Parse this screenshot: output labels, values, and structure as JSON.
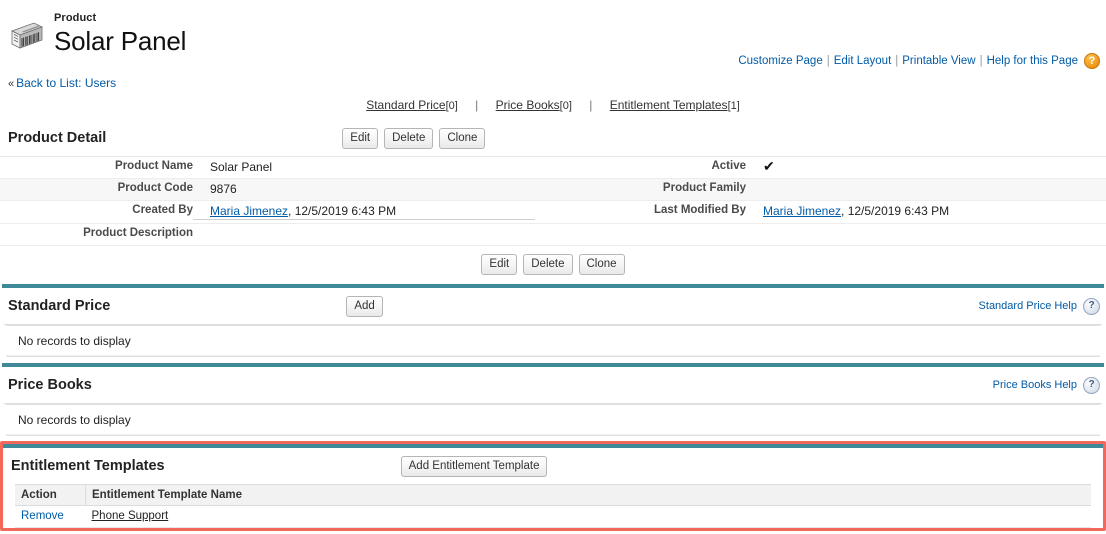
{
  "header": {
    "record_type_label": "Product",
    "record_name": "Solar Panel",
    "icon": "barcode-product-icon"
  },
  "top_links": {
    "items": [
      {
        "label": "Customize Page"
      },
      {
        "label": "Edit Layout"
      },
      {
        "label": "Printable View"
      },
      {
        "label": "Help for this Page"
      }
    ],
    "separator": "|",
    "help_icon_glyph": "?",
    "help_icon_color": "#f0981d"
  },
  "back_to_list": {
    "chevron": "«",
    "label": "Back to List: Users"
  },
  "quick_links": {
    "separator": "|",
    "items": [
      {
        "label": "Standard Price",
        "count": "[0]"
      },
      {
        "label": "Price Books",
        "count": "[0]"
      },
      {
        "label": "Entitlement Templates",
        "count": "[1]"
      }
    ]
  },
  "product_detail": {
    "title": "Product Detail",
    "buttons": [
      {
        "label": "Edit"
      },
      {
        "label": "Delete"
      },
      {
        "label": "Clone"
      }
    ],
    "rows": [
      {
        "left_label": "Product Name",
        "left_value": "Solar Panel",
        "right_label": "Active",
        "right_value": "✔"
      },
      {
        "left_label": "Product Code",
        "left_value": "9876",
        "right_label": "Product Family",
        "right_value": ""
      },
      {
        "left_label": "Created By",
        "left_value_link": "Maria Jimenez",
        "left_value_rest": ", 12/5/2019 6:43 PM",
        "right_label": "Last Modified By",
        "right_value_link": "Maria Jimenez",
        "right_value_rest": ", 12/5/2019 6:43 PM"
      },
      {
        "left_label": "Product Description",
        "left_value": "",
        "right_label": "",
        "right_value": ""
      }
    ]
  },
  "standard_price": {
    "title": "Standard Price",
    "add_button": "Add",
    "help_link": "Standard Price Help",
    "help_icon_glyph": "?",
    "empty_message": "No records to display"
  },
  "price_books": {
    "title": "Price Books",
    "help_link": "Price Books Help",
    "help_icon_glyph": "?",
    "empty_message": "No records to display"
  },
  "entitlement_templates": {
    "title": "Entitlement Templates",
    "add_button": "Add Entitlement Template",
    "highlight_color": "#f2695c",
    "columns": [
      {
        "label": "Action"
      },
      {
        "label": "Entitlement Template Name"
      }
    ],
    "rows": [
      {
        "action": "Remove",
        "name": "Phone Support"
      }
    ]
  },
  "theme": {
    "section_bar_color": "#3e8a99",
    "link_color": "#015ba7",
    "highlight_border": "#f2695c"
  }
}
